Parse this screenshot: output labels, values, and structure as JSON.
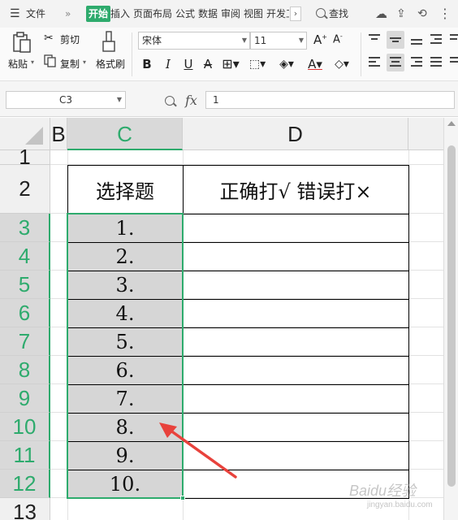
{
  "menubar": {
    "menu_label": "文件",
    "active_tab": "开始",
    "tabs": [
      "插入",
      "页面布局",
      "公式",
      "数据",
      "审阅",
      "视图",
      "开发工"
    ],
    "search_label": "查找"
  },
  "ribbon": {
    "paste_label": "粘贴",
    "cut_label": "剪切",
    "copy_label": "复制",
    "format_painter_label": "格式刷",
    "font_name": "宋体",
    "font_size": "11"
  },
  "formula_bar": {
    "cell_ref": "C3",
    "fx_label": "fx",
    "value": "1"
  },
  "grid": {
    "columns": [
      "B",
      "C",
      "D"
    ],
    "selected_column": "C",
    "rows": [
      "1",
      "2",
      "3",
      "4",
      "5",
      "6",
      "7",
      "8",
      "9",
      "10",
      "11",
      "12",
      "13"
    ],
    "header_cells": {
      "c2": "选择题",
      "d2": "正确打√ 错误打×"
    },
    "c_values": [
      "1.",
      "2.",
      "3.",
      "4.",
      "5.",
      "6.",
      "7.",
      "8.",
      "9.",
      "10."
    ]
  },
  "watermark": {
    "text": "Baidu经验",
    "sub": "jingyan.baidu.com"
  },
  "colors": {
    "accent": "#2eab6d",
    "arrow": "#e8423c"
  }
}
